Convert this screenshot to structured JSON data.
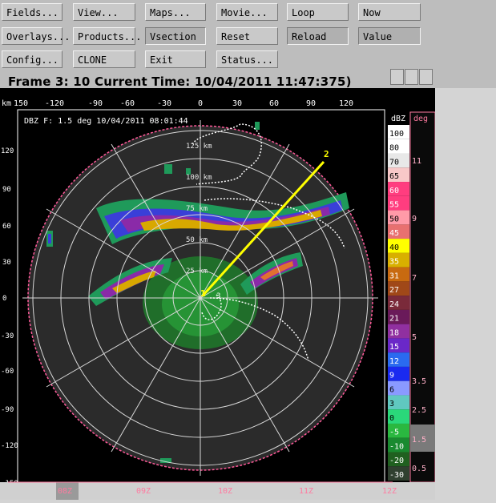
{
  "toolbar": {
    "row1": [
      "Fields...",
      "View...",
      "Maps...",
      "Movie...",
      "Loop",
      "Now"
    ],
    "row2": [
      "Overlays...",
      "Products...",
      "Vsection",
      "Reset",
      "Reload",
      "Value"
    ],
    "row3": [
      "Config...",
      "CLONE",
      "Exit",
      "Status..."
    ]
  },
  "frame_title": "Frame 3: 10 Current Time: 10/04/2011 11:47:375)",
  "display": {
    "km_label": "km",
    "x_ticks": [
      "150",
      "-120",
      "-90",
      "-60",
      "-30",
      "0",
      "30",
      "60",
      "90",
      "120"
    ],
    "y_ticks": [
      "120",
      "90",
      "60",
      "30",
      "0",
      "-30",
      "-60",
      "-90",
      "-120",
      "-150"
    ],
    "field_label": "DBZ F: 1.5 deg 10/04/2011 08:01:44",
    "range_labels": [
      "25 km",
      "50 km",
      "75 km",
      "100 km",
      "125 km"
    ],
    "vsection_points": [
      "1",
      "2"
    ],
    "small_label": "3"
  },
  "color_scale": {
    "unit": "dBZ",
    "levels": [
      "100",
      "80",
      "70",
      "65",
      "60",
      "55",
      "50",
      "45",
      "40",
      "35",
      "31",
      "27",
      "24",
      "21",
      "18",
      "15",
      "12",
      "9",
      "6",
      "3",
      "0",
      "-5",
      "-10",
      "-20",
      "-30"
    ],
    "colors": [
      "#ffffff",
      "#ffffff",
      "#e8e8e8",
      "#f8c8c8",
      "#ff3d7f",
      "#ff3d7f",
      "#ff9aa8",
      "#e87070",
      "#ffff00",
      "#d8b000",
      "#c86a10",
      "#a04818",
      "#7a2a3a",
      "#6a1a5a",
      "#9030a0",
      "#6a28c8",
      "#2a6af0",
      "#1a2af0",
      "#8a9aff",
      "#60c8c0",
      "#2ad87a",
      "#2ab840",
      "#1a8a30",
      "#206020",
      "#304030"
    ]
  },
  "elevation_scale": {
    "unit": "deg",
    "labels": [
      "11",
      "9",
      "7",
      "5",
      "3.5",
      "2.5",
      "1.5",
      "0.5"
    ],
    "selected": "1.5"
  },
  "time_axis": {
    "labels": [
      "08Z",
      "09Z",
      "10Z",
      "11Z",
      "12Z"
    ]
  }
}
